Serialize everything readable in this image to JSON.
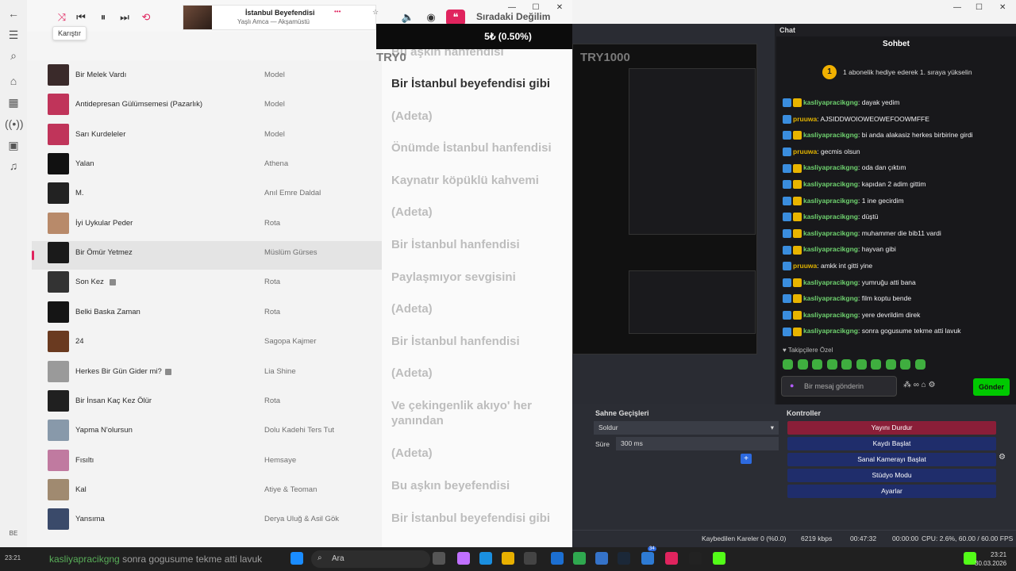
{
  "player": {
    "tooltip": "Karıştır",
    "now_playing_title": "İstanbul Beyefendisi",
    "now_playing_artist": "Yaşlı Amca — Akşamüstü",
    "more": "•••"
  },
  "overlay": {
    "title": "Sıradaki Değilim",
    "bar_text": "5₺ (0.50%)",
    "left_tag": "TRY0",
    "right_tag": "TRY1000"
  },
  "tracks": [
    {
      "title": "Bir Melek Vardı",
      "artist": "Model",
      "color": "#3a2a2a"
    },
    {
      "title": "Antidepresan Gülümsemesi (Pazarlık)",
      "artist": "Model",
      "color": "#c0345a"
    },
    {
      "title": "Sarı Kurdeleler",
      "artist": "Model",
      "color": "#c0345a"
    },
    {
      "title": "Yalan",
      "artist": "Athena",
      "color": "#111111"
    },
    {
      "title": "M.",
      "artist": "Anıl Emre Daldal",
      "color": "#222222"
    },
    {
      "title": "İyi Uykular Peder",
      "artist": "Rota",
      "color": "#b88a6a"
    },
    {
      "title": "Bir Ömür Yetmez",
      "artist": "Müslüm Gürses",
      "color": "#1a1a1a"
    },
    {
      "title": "Son Kez",
      "artist": "Rota",
      "color": "#333333",
      "explicit": true
    },
    {
      "title": "Belki Baska Zaman",
      "artist": "Rota",
      "color": "#151515"
    },
    {
      "title": "24",
      "artist": "Sagopa Kajmer",
      "color": "#6a3a20"
    },
    {
      "title": "Herkes Bir Gün Gider mi?",
      "artist": "Lia Shine",
      "color": "#9a9a9a",
      "explicit": true
    },
    {
      "title": "Bir İnsan Kaç Kez Ölür",
      "artist": "Rota",
      "color": "#202020"
    },
    {
      "title": "Yapma N'olursun",
      "artist": "Dolu Kadehi Ters Tut",
      "color": "#8899aa"
    },
    {
      "title": "Fısıltı",
      "artist": "Hemsaye",
      "color": "#c07aa0"
    },
    {
      "title": "Kal",
      "artist": "Atiye & Teoman",
      "color": "#a08a70"
    },
    {
      "title": "Yansıma",
      "artist": "Derya Uluğ & Asil Gök",
      "color": "#3a4a6a"
    }
  ],
  "lyrics": [
    "Bu aşkın hanfendisi",
    "Bir İstanbul beyefendisi gibi",
    "(Adeta)",
    "Önümde İstanbul hanfendisi",
    "Kaynatır köpüklü kahvemi",
    "(Adeta)",
    "Bir İstanbul hanfendisi",
    "Paylaşmıyor sevgisini",
    "(Adeta)",
    "Bir İstanbul hanfendisi",
    "(Adeta)",
    "Ve çekingenlik akıyo' her yanından",
    "(Adeta)",
    "Bu aşkın beyefendisi",
    "Bir İstanbul beyefendisi gibi"
  ],
  "chat": {
    "header": "Chat",
    "title": "Sohbet",
    "gift_text": "1 abonelik hediye ederek 1. sıraya yükselin",
    "gift_number": "1",
    "messages": [
      {
        "user": "kasliyapracikgng",
        "text": "dayak yedim",
        "color": "#6fd36f"
      },
      {
        "user": "pruuwa",
        "text": "AJSIDDWOIOWEOWEFOOWMFFE",
        "color": "#e0b200"
      },
      {
        "user": "kasliyapracikgng",
        "text": "bi anda alakasiz herkes birbirine girdi",
        "color": "#6fd36f"
      },
      {
        "user": "pruuwa",
        "text": "gecmis olsun",
        "color": "#e0b200"
      },
      {
        "user": "kasliyapracikgng",
        "text": "oda dan çıktım",
        "color": "#6fd36f"
      },
      {
        "user": "kasliyapracikgng",
        "text": "kapıdan 2 adim gittim",
        "color": "#6fd36f"
      },
      {
        "user": "kasliyapracikgng",
        "text": "1 ine gecirdim",
        "color": "#6fd36f"
      },
      {
        "user": "kasliyapracikgng",
        "text": "düştü",
        "color": "#6fd36f"
      },
      {
        "user": "kasliyapracikgng",
        "text": "muhammer die bib11 vardi",
        "color": "#6fd36f"
      },
      {
        "user": "kasliyapracikgng",
        "text": "hayvan gibi",
        "color": "#6fd36f"
      },
      {
        "user": "pruuwa",
        "text": "amkk int gitti yine",
        "color": "#e0b200"
      },
      {
        "user": "kasliyapracikgng",
        "text": "yumruğu atti bana",
        "color": "#6fd36f"
      },
      {
        "user": "kasliyapracikgng",
        "text": "film koptu bende",
        "color": "#6fd36f"
      },
      {
        "user": "kasliyapracikgng",
        "text": "yere devrildim direk",
        "color": "#6fd36f"
      },
      {
        "user": "kasliyapracikgng",
        "text": "sonra gogusume tekme atti lavuk",
        "color": "#6fd36f"
      }
    ],
    "special_label": "Takipçilere Özel",
    "input_placeholder": "Bir mesaj gönderin",
    "send_label": "Gönder"
  },
  "obs": {
    "transitions_title": "Sahne Geçişleri",
    "transition_value": "Soldur",
    "duration_label": "Süre",
    "duration_value": "300 ms",
    "controls_title": "Kontroller",
    "controls": [
      {
        "label": "Yayını Durdur",
        "color": "#8a1e38"
      },
      {
        "label": "Kaydı Başlat",
        "color": "#1f2d6b"
      },
      {
        "label": "Sanal Kamerayı Başlat",
        "color": "#1f2d6b"
      },
      {
        "label": "Stüdyo Modu",
        "color": "#1f2d6b"
      },
      {
        "label": "Ayarlar",
        "color": "#1f2d6b"
      }
    ],
    "status": {
      "dropped": "Kaybedilen Kareler 0 (%0.0)",
      "bitrate": "6219 kbps",
      "stream_time": "00:47:32",
      "rec_time": "00:00:00",
      "cpu": "CPU: 2.6%, 60.00 / 60.00 FPS"
    }
  },
  "taskbar": {
    "ticker_user": "kasliyapracikgng",
    "ticker_text": "sonra gogusume tekme atti lavuk",
    "search_placeholder": "Ara",
    "time": "23:21",
    "date": "30.03.2026",
    "badge": "34"
  }
}
